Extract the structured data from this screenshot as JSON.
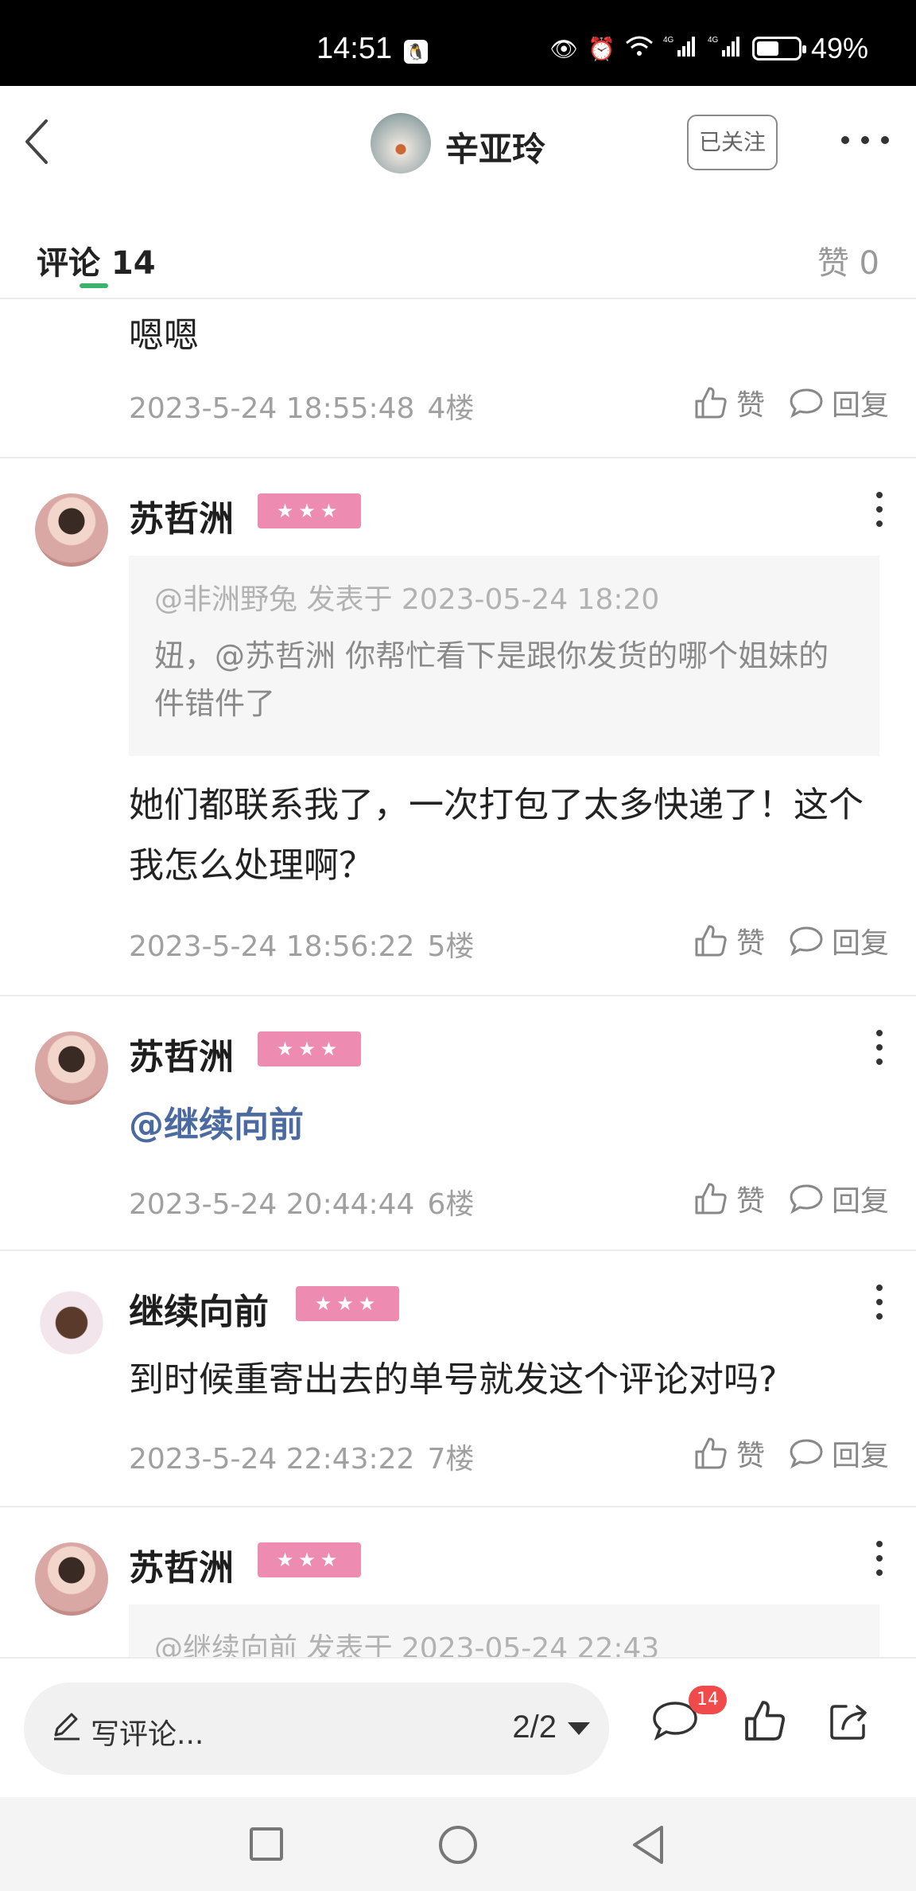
{
  "status_bar": {
    "time": "14:51",
    "network": "4G",
    "battery": "49%",
    "battery_level": 0.49
  },
  "header": {
    "author_name": "辛亚玲",
    "follow_label": "已关注"
  },
  "tabs": {
    "comments_label": "评论 14",
    "likes_label": "赞 0"
  },
  "comments": [
    {
      "text": "嗯嗯",
      "time": "2023-5-24 18:55:48",
      "floor": "4楼",
      "like_label": "赞",
      "reply_label": "回复"
    },
    {
      "user": "苏哲洲",
      "badge": "★★★",
      "quote_head": "@非洲野兔 发表于 2023-05-24 18:20",
      "quote_text": "妞，@苏哲洲 你帮忙看下是跟你发货的哪个姐妹的件错件了",
      "text": "她们都联系我了，一次打包了太多快递了！这个我怎么处理啊？",
      "time": "2023-5-24 18:56:22",
      "floor": "5楼",
      "like_label": "赞",
      "reply_label": "回复"
    },
    {
      "user": "苏哲洲",
      "badge": "★★★",
      "text": "@继续向前",
      "time": "2023-5-24 20:44:44",
      "floor": "6楼",
      "like_label": "赞",
      "reply_label": "回复"
    },
    {
      "user": "继续向前",
      "badge": "★★★",
      "text": "到时候重寄出去的单号就发这个评论对吗?",
      "time": "2023-5-24 22:43:22",
      "floor": "7楼",
      "like_label": "赞",
      "reply_label": "回复"
    },
    {
      "user": "苏哲洲",
      "badge": "★★★",
      "quote_head": "@继续向前 发表于 2023-05-24 22:43"
    }
  ],
  "bottom_bar": {
    "write_placeholder": "写评论...",
    "pager": "2/2",
    "comment_count": "14"
  },
  "colors": {
    "accent_green": "#3bb36a",
    "badge_pink": "#ee8bb0",
    "mention_blue": "#4a6aa1",
    "count_red": "#f04a4a"
  },
  "icons": [
    "back-icon",
    "more-icon",
    "like-icon",
    "reply-icon",
    "pencil-icon",
    "comment-icon",
    "share-icon",
    "kebab-icon"
  ]
}
